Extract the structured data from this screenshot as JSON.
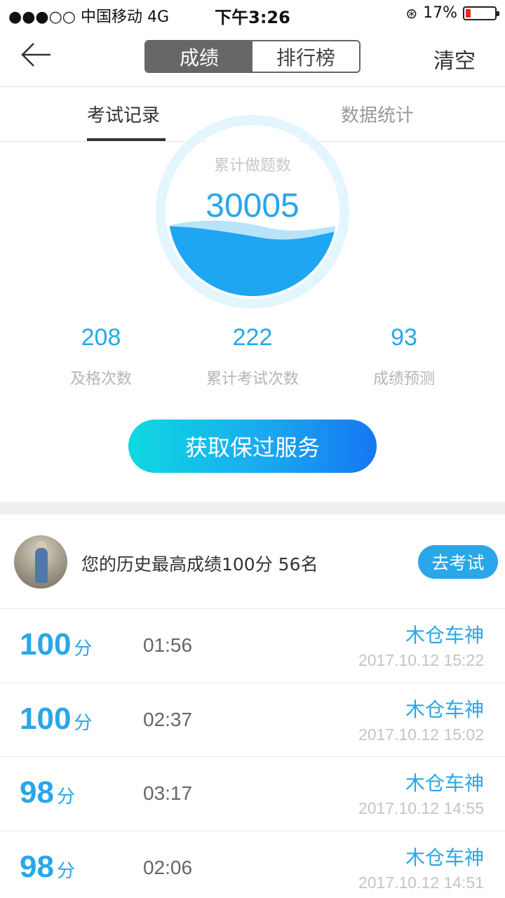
{
  "status_bar": {
    "carrier": "●●●○○ 中国移动   4G",
    "time": "下午3:26",
    "battery": "17%",
    "battery_level": 0.17
  },
  "nav": {
    "segments": [
      "成绩",
      "排行榜"
    ],
    "active_segment": "成绩",
    "clear_label": "清空"
  },
  "tabs": [
    "考试记录",
    "数据统计"
  ],
  "gauge": {
    "label": "累计做题数",
    "value": "30005",
    "colors": {
      "ring": "#e3f5fd",
      "water": "#1fa6f2",
      "wave": "#b9e3fb"
    }
  },
  "stats": [
    {
      "value": "208",
      "label": "及格次数"
    },
    {
      "value": "222",
      "label": "累计考试次数"
    },
    {
      "value": "93",
      "label": "成绩预测"
    }
  ],
  "cta": {
    "label": "获取保过服务"
  },
  "best": {
    "text": "您的历史最高成绩100分  56名",
    "button": "去考试"
  },
  "records": [
    {
      "score": "100",
      "unit": "分",
      "duration": "01:56",
      "name": "木仓车神",
      "date": "2017.10.12 15:22"
    },
    {
      "score": "100",
      "unit": "分",
      "duration": "02:37",
      "name": "木仓车神",
      "date": "2017.10.12 15:02"
    },
    {
      "score": "98",
      "unit": "分",
      "duration": "03:17",
      "name": "木仓车神",
      "date": "2017.10.12 14:55"
    },
    {
      "score": "98",
      "unit": "分",
      "duration": "02:06",
      "name": "木仓车神",
      "date": "2017.10.12 14:51"
    }
  ],
  "colors": {
    "accent": "#29a7e8",
    "muted": "#b5b5b5"
  }
}
